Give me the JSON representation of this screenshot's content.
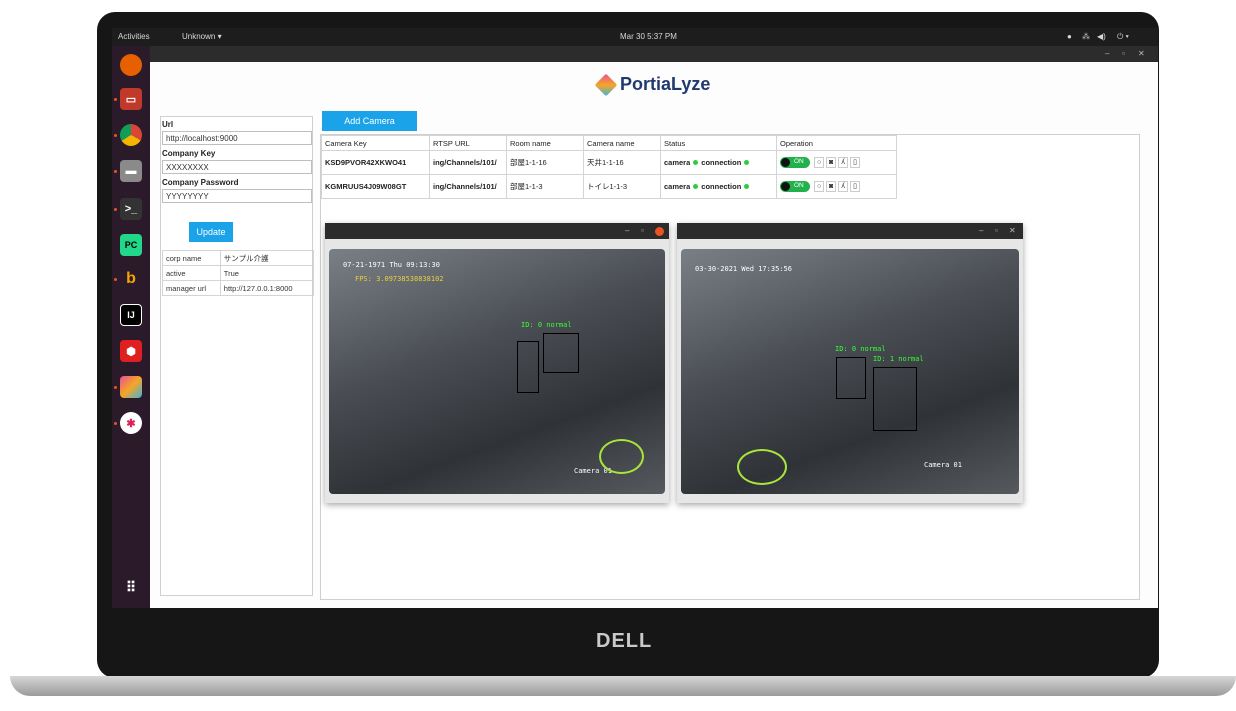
{
  "topbar": {
    "activities": "Activities",
    "app_menu": "Unknown ▾",
    "clock": "Mar 30  5:37 PM"
  },
  "brand": {
    "name": "PortiaLyze"
  },
  "left_panel": {
    "url_label": "Url",
    "url_value": "http://localhost:9000",
    "company_key_label": "Company Key",
    "company_key_value": "XXXXXXXX",
    "company_password_label": "Company Password",
    "company_password_value": "YYYYYYYY",
    "update_button": "Update",
    "info_rows": [
      {
        "key": "corp name",
        "value": "サンプル介護"
      },
      {
        "key": "active",
        "value": "True"
      },
      {
        "key": "manager url",
        "value": "http://127.0.0.1:8000"
      }
    ]
  },
  "add_camera_button": "Add Camera",
  "camera_table": {
    "headers": [
      "Camera Key",
      "RTSP URL",
      "Room name",
      "Camera name",
      "Status",
      "Operation"
    ],
    "rows": [
      {
        "key": "KSD9PVOR42XKWO41",
        "rtsp": "ing/Channels/101/",
        "room": "部屋1-1-16",
        "camera": "天井1-1-16",
        "status_camera": "camera",
        "status_connection": "connection",
        "toggle": "ON"
      },
      {
        "key": "KGMRUUS4J09W08GT",
        "rtsp": "ing/Channels/101/",
        "room": "部屋1-1-3",
        "camera": "トイレ1-1-3",
        "status_camera": "camera",
        "status_connection": "connection",
        "toggle": "ON"
      }
    ]
  },
  "camera_windows": [
    {
      "osd_time": "07-21-1971 Thu 09:13:30",
      "osd_fps": "FPS: 3.09738538838102",
      "osd_label": "Camera 01",
      "person_label": "ID: 0 normal"
    },
    {
      "osd_time": "03-30-2021 Wed 17:35:56",
      "osd_label": "Camera 01",
      "person_label_1": "ID: 0 normal",
      "person_label_2": "ID: 1 normal"
    }
  ],
  "laptop_brand": "DELL",
  "colors": {
    "accent": "#1aa3e8",
    "status_green": "#2ecc40",
    "toggle_green": "#22b14c",
    "ubuntu_orange": "#e95420"
  }
}
